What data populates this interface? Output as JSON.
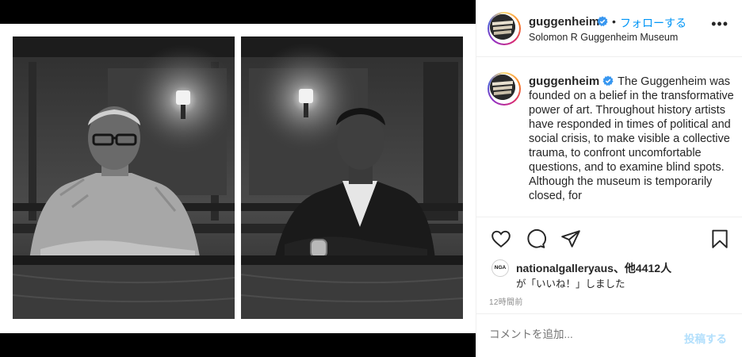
{
  "post": {
    "username": "guggenheim",
    "verified": true,
    "follow_label": "フォローする",
    "location": "Solomon R Guggenheim Museum",
    "more_label": "•••",
    "caption": "The Guggenheim was founded on a belief in the transformative power of art. Throughout history artists have responded in times of political and social crisis, to make visible a collective trauma, to confront uncomfortable questions, and to examine blind spots. Although the museum is temporarily closed, for",
    "likes_user": "nationalgalleryaus",
    "likes_avatar": "NGA",
    "likes_rest": "、他4412人",
    "likes_line2": "が「いいね！」しました",
    "time": "12時間前",
    "comment_placeholder": "コメントを追加...",
    "post_label": "投稿する"
  },
  "colors": {
    "accent": "#0095f6",
    "accent_disabled": "#b2dffc",
    "text": "#262626",
    "muted": "#8e8e8e",
    "divider": "#efefef",
    "verified": "#3897f0"
  },
  "icons": [
    "heart-icon",
    "comment-icon",
    "share-icon",
    "bookmark-icon",
    "verified-badge-icon",
    "more-options-icon"
  ]
}
